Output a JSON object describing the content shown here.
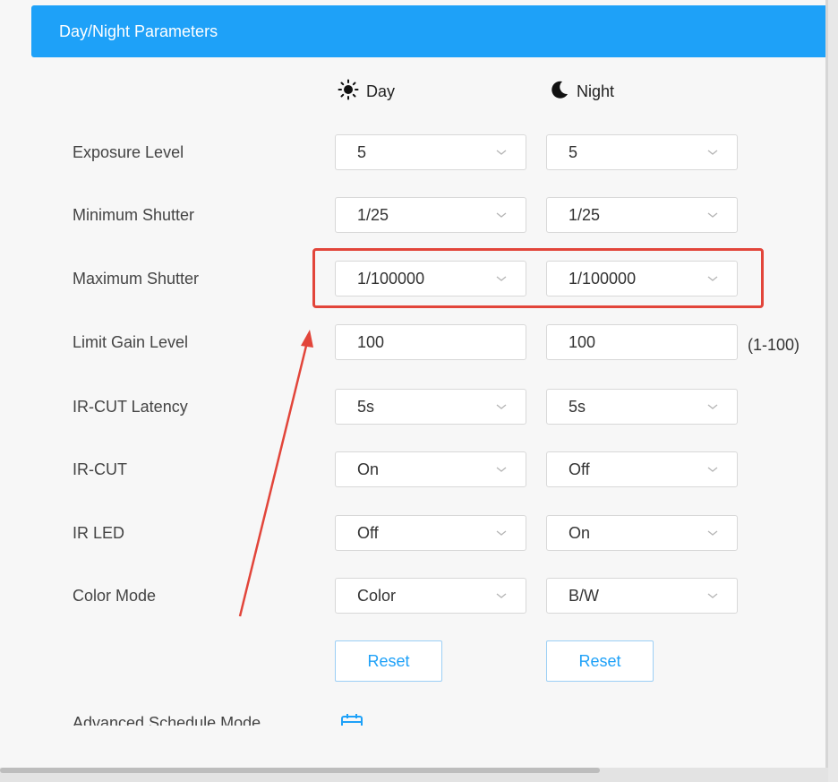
{
  "panel": {
    "title": "Day/Night Parameters",
    "columns": [
      {
        "label": "Day",
        "icon": "sun-icon"
      },
      {
        "label": "Night",
        "icon": "moon-icon"
      }
    ]
  },
  "rows": [
    {
      "label": "Exposure Level",
      "day": "5",
      "night": "5",
      "type": "select"
    },
    {
      "label": "Minimum Shutter",
      "day": "1/25",
      "night": "1/25",
      "type": "select"
    },
    {
      "label": "Maximum Shutter",
      "day": "1/100000",
      "night": "1/100000",
      "type": "select"
    },
    {
      "label": "Limit Gain Level",
      "day": "100",
      "night": "100",
      "type": "input",
      "range": "(1-100)"
    },
    {
      "label": "IR-CUT Latency",
      "day": "5s",
      "night": "5s",
      "type": "select"
    },
    {
      "label": "IR-CUT",
      "day": "On",
      "night": "Off",
      "type": "select"
    },
    {
      "label": "IR LED",
      "day": "Off",
      "night": "On",
      "type": "select"
    },
    {
      "label": "Color Mode",
      "day": "Color",
      "night": "B/W",
      "type": "select"
    }
  ],
  "buttons": {
    "day_reset": "Reset",
    "night_reset": "Reset"
  },
  "advanced": {
    "label": "Advanced Schedule Mode",
    "icon": "calendar-icon"
  },
  "colors": {
    "accent": "#1ea1f8",
    "highlight": "#e2453a"
  }
}
